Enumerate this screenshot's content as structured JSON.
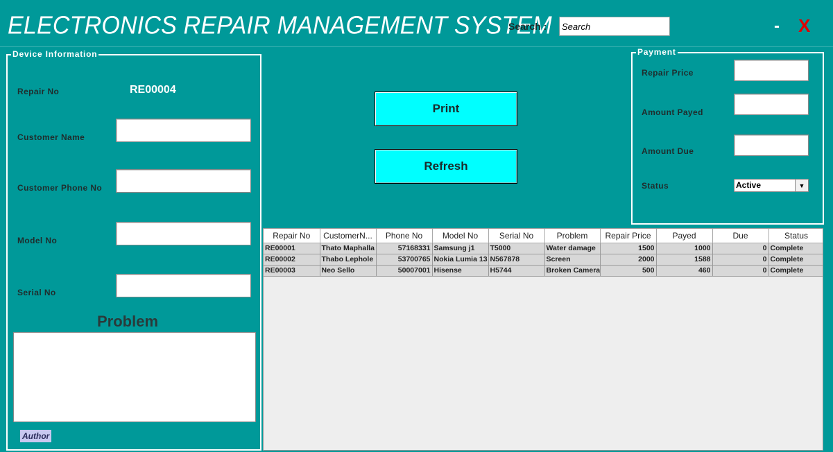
{
  "app": {
    "title": "ELECTRONICS REPAIR MANAGEMENT SYSTEM",
    "minimize_label": "-",
    "close_label": "X",
    "close_color": "#e00000"
  },
  "search": {
    "label": "Search :",
    "placeholder": "Search"
  },
  "device_info": {
    "group_title": "Device Information",
    "repair_no_label": "Repair No",
    "repair_no_value": "RE00004",
    "customer_name_label": "Customer Name",
    "customer_phone_label": "Customer Phone No",
    "model_no_label": "Model No",
    "serial_no_label": "Serial No",
    "problem_label": "Problem",
    "author_label": "Author"
  },
  "actions": {
    "print_label": "Print",
    "refresh_label": "Refresh"
  },
  "payment": {
    "group_title": "Payment",
    "repair_price_label": "Repair Price",
    "amount_payed_label": "Amount Payed",
    "amount_due_label": "Amount Due",
    "status_label": "Status",
    "status_value": "Active"
  },
  "table": {
    "columns": [
      "Repair No",
      "CustomerN...",
      "Phone No",
      "Model No",
      "Serial No",
      "Problem",
      "Repair Price",
      "Payed",
      "Due",
      "Status"
    ],
    "rows": [
      [
        "RE00001",
        "Thato Maphalla",
        "57168331",
        "Samsung j1",
        "T5000",
        "Water damage",
        "1500",
        "1000",
        "0",
        "Complete"
      ],
      [
        "RE00002",
        "Thabo Lephole",
        "53700765",
        "Nokia Lumia 13",
        "N567878",
        "Screen",
        "2000",
        "1588",
        "0",
        "Complete"
      ],
      [
        "RE00003",
        "Neo Sello",
        "50007001",
        "Hisense",
        "H5744",
        "Broken Camera",
        "500",
        "460",
        "0",
        "Complete"
      ]
    ]
  },
  "colors": {
    "background": "#009999",
    "button": "#00ffff",
    "table_row": "#d8d8d8"
  }
}
